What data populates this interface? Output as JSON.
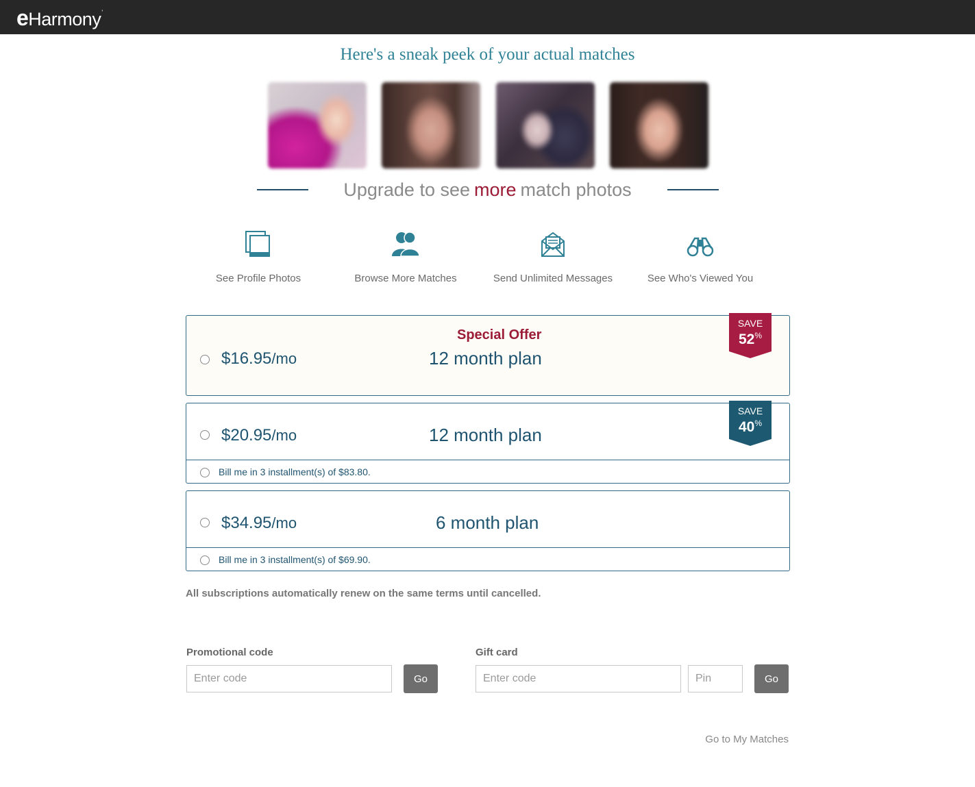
{
  "header": {
    "logo_e": "e",
    "logo_rest": "Harmony",
    "logo_mark": "'"
  },
  "headline": "Here's a sneak peek of your actual matches",
  "photos": [
    "match-photo-1",
    "match-photo-2",
    "match-photo-3",
    "match-photo-4"
  ],
  "upgrade": {
    "before": "Upgrade to see",
    "highlight": "more",
    "after": "match photos"
  },
  "features": [
    {
      "label": "See Profile Photos",
      "icon": "photos-icon"
    },
    {
      "label": "Browse More Matches",
      "icon": "people-icon"
    },
    {
      "label": "Send Unlimited Messages",
      "icon": "envelope-icon"
    },
    {
      "label": "See Who's Viewed You",
      "icon": "binoculars-icon"
    }
  ],
  "plans": [
    {
      "offer": "Special Offer",
      "price": "$16.95",
      "per": "/mo",
      "name": "12 month plan",
      "badge_save": "SAVE",
      "badge_pct": "52",
      "badge_sym": "%",
      "badge_color": "#a61c43"
    },
    {
      "price": "$20.95",
      "per": "/mo",
      "name": "12 month plan",
      "badge_save": "SAVE",
      "badge_pct": "40",
      "badge_sym": "%",
      "badge_color": "#1d5a72",
      "installment": "Bill me in 3 installment(s) of $83.80."
    },
    {
      "price": "$34.95",
      "per": "/mo",
      "name": "6 month plan",
      "installment": "Bill me in 3 installment(s) of $69.90."
    }
  ],
  "renew_note": "All subscriptions automatically renew on the same terms until cancelled.",
  "promo": {
    "label": "Promotional code",
    "placeholder": "Enter code",
    "button": "Go"
  },
  "gift": {
    "label": "Gift card",
    "code_placeholder": "Enter code",
    "pin_placeholder": "Pin",
    "button": "Go"
  },
  "footer_link": "Go to My Matches"
}
